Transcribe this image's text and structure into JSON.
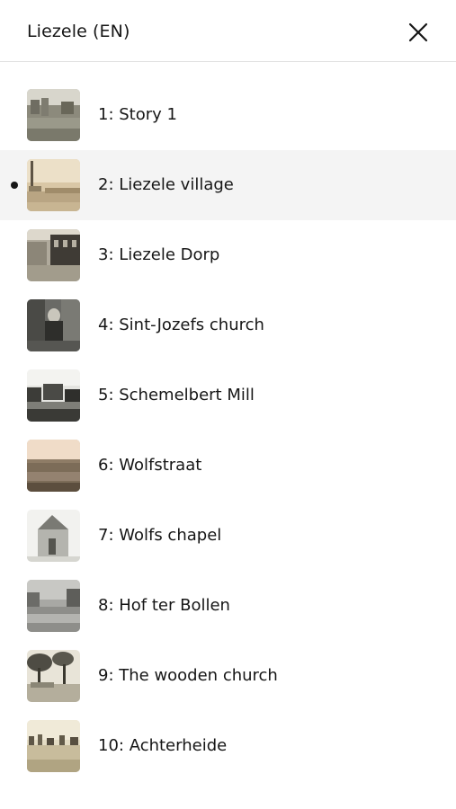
{
  "header": {
    "title": "Liezele (EN)",
    "close_icon": "close-icon"
  },
  "chapters": [
    {
      "label": "1: Story 1",
      "active": false,
      "thumbnail": "thumb-photo-1"
    },
    {
      "label": "2: Liezele village",
      "active": true,
      "thumbnail": "thumb-photo-2"
    },
    {
      "label": "3: Liezele Dorp",
      "active": false,
      "thumbnail": "thumb-photo-3"
    },
    {
      "label": "4: Sint-Jozefs church",
      "active": false,
      "thumbnail": "thumb-photo-4"
    },
    {
      "label": "5: Schemelbert Mill",
      "active": false,
      "thumbnail": "thumb-photo-5"
    },
    {
      "label": "6: Wolfstraat",
      "active": false,
      "thumbnail": "thumb-photo-6"
    },
    {
      "label": "7: Wolfs chapel",
      "active": false,
      "thumbnail": "thumb-photo-7"
    },
    {
      "label": "8: Hof ter Bollen",
      "active": false,
      "thumbnail": "thumb-photo-8"
    },
    {
      "label": "9: The wooden church",
      "active": false,
      "thumbnail": "thumb-photo-9"
    },
    {
      "label": "10: Achterheide",
      "active": false,
      "thumbnail": "thumb-photo-10"
    }
  ],
  "colors": {
    "text": "#161616",
    "active_row_bg": "#f4f4f4",
    "divider": "#e0e0e0"
  }
}
